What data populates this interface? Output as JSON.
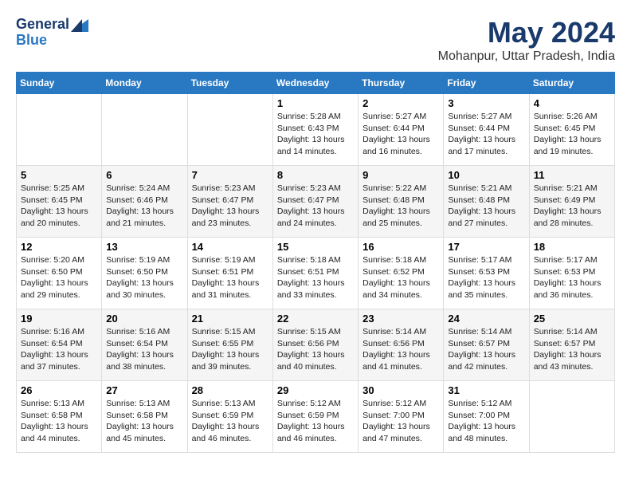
{
  "logo": {
    "general": "General",
    "blue": "Blue"
  },
  "header": {
    "month": "May 2024",
    "location": "Mohanpur, Uttar Pradesh, India"
  },
  "weekdays": [
    "Sunday",
    "Monday",
    "Tuesday",
    "Wednesday",
    "Thursday",
    "Friday",
    "Saturday"
  ],
  "rows": [
    [
      {
        "day": "",
        "content": ""
      },
      {
        "day": "",
        "content": ""
      },
      {
        "day": "",
        "content": ""
      },
      {
        "day": "1",
        "content": "Sunrise: 5:28 AM\nSunset: 6:43 PM\nDaylight: 13 hours\nand 14 minutes."
      },
      {
        "day": "2",
        "content": "Sunrise: 5:27 AM\nSunset: 6:44 PM\nDaylight: 13 hours\nand 16 minutes."
      },
      {
        "day": "3",
        "content": "Sunrise: 5:27 AM\nSunset: 6:44 PM\nDaylight: 13 hours\nand 17 minutes."
      },
      {
        "day": "4",
        "content": "Sunrise: 5:26 AM\nSunset: 6:45 PM\nDaylight: 13 hours\nand 19 minutes."
      }
    ],
    [
      {
        "day": "5",
        "content": "Sunrise: 5:25 AM\nSunset: 6:45 PM\nDaylight: 13 hours\nand 20 minutes."
      },
      {
        "day": "6",
        "content": "Sunrise: 5:24 AM\nSunset: 6:46 PM\nDaylight: 13 hours\nand 21 minutes."
      },
      {
        "day": "7",
        "content": "Sunrise: 5:23 AM\nSunset: 6:47 PM\nDaylight: 13 hours\nand 23 minutes."
      },
      {
        "day": "8",
        "content": "Sunrise: 5:23 AM\nSunset: 6:47 PM\nDaylight: 13 hours\nand 24 minutes."
      },
      {
        "day": "9",
        "content": "Sunrise: 5:22 AM\nSunset: 6:48 PM\nDaylight: 13 hours\nand 25 minutes."
      },
      {
        "day": "10",
        "content": "Sunrise: 5:21 AM\nSunset: 6:48 PM\nDaylight: 13 hours\nand 27 minutes."
      },
      {
        "day": "11",
        "content": "Sunrise: 5:21 AM\nSunset: 6:49 PM\nDaylight: 13 hours\nand 28 minutes."
      }
    ],
    [
      {
        "day": "12",
        "content": "Sunrise: 5:20 AM\nSunset: 6:50 PM\nDaylight: 13 hours\nand 29 minutes."
      },
      {
        "day": "13",
        "content": "Sunrise: 5:19 AM\nSunset: 6:50 PM\nDaylight: 13 hours\nand 30 minutes."
      },
      {
        "day": "14",
        "content": "Sunrise: 5:19 AM\nSunset: 6:51 PM\nDaylight: 13 hours\nand 31 minutes."
      },
      {
        "day": "15",
        "content": "Sunrise: 5:18 AM\nSunset: 6:51 PM\nDaylight: 13 hours\nand 33 minutes."
      },
      {
        "day": "16",
        "content": "Sunrise: 5:18 AM\nSunset: 6:52 PM\nDaylight: 13 hours\nand 34 minutes."
      },
      {
        "day": "17",
        "content": "Sunrise: 5:17 AM\nSunset: 6:53 PM\nDaylight: 13 hours\nand 35 minutes."
      },
      {
        "day": "18",
        "content": "Sunrise: 5:17 AM\nSunset: 6:53 PM\nDaylight: 13 hours\nand 36 minutes."
      }
    ],
    [
      {
        "day": "19",
        "content": "Sunrise: 5:16 AM\nSunset: 6:54 PM\nDaylight: 13 hours\nand 37 minutes."
      },
      {
        "day": "20",
        "content": "Sunrise: 5:16 AM\nSunset: 6:54 PM\nDaylight: 13 hours\nand 38 minutes."
      },
      {
        "day": "21",
        "content": "Sunrise: 5:15 AM\nSunset: 6:55 PM\nDaylight: 13 hours\nand 39 minutes."
      },
      {
        "day": "22",
        "content": "Sunrise: 5:15 AM\nSunset: 6:56 PM\nDaylight: 13 hours\nand 40 minutes."
      },
      {
        "day": "23",
        "content": "Sunrise: 5:14 AM\nSunset: 6:56 PM\nDaylight: 13 hours\nand 41 minutes."
      },
      {
        "day": "24",
        "content": "Sunrise: 5:14 AM\nSunset: 6:57 PM\nDaylight: 13 hours\nand 42 minutes."
      },
      {
        "day": "25",
        "content": "Sunrise: 5:14 AM\nSunset: 6:57 PM\nDaylight: 13 hours\nand 43 minutes."
      }
    ],
    [
      {
        "day": "26",
        "content": "Sunrise: 5:13 AM\nSunset: 6:58 PM\nDaylight: 13 hours\nand 44 minutes."
      },
      {
        "day": "27",
        "content": "Sunrise: 5:13 AM\nSunset: 6:58 PM\nDaylight: 13 hours\nand 45 minutes."
      },
      {
        "day": "28",
        "content": "Sunrise: 5:13 AM\nSunset: 6:59 PM\nDaylight: 13 hours\nand 46 minutes."
      },
      {
        "day": "29",
        "content": "Sunrise: 5:12 AM\nSunset: 6:59 PM\nDaylight: 13 hours\nand 46 minutes."
      },
      {
        "day": "30",
        "content": "Sunrise: 5:12 AM\nSunset: 7:00 PM\nDaylight: 13 hours\nand 47 minutes."
      },
      {
        "day": "31",
        "content": "Sunrise: 5:12 AM\nSunset: 7:00 PM\nDaylight: 13 hours\nand 48 minutes."
      },
      {
        "day": "",
        "content": ""
      }
    ]
  ]
}
